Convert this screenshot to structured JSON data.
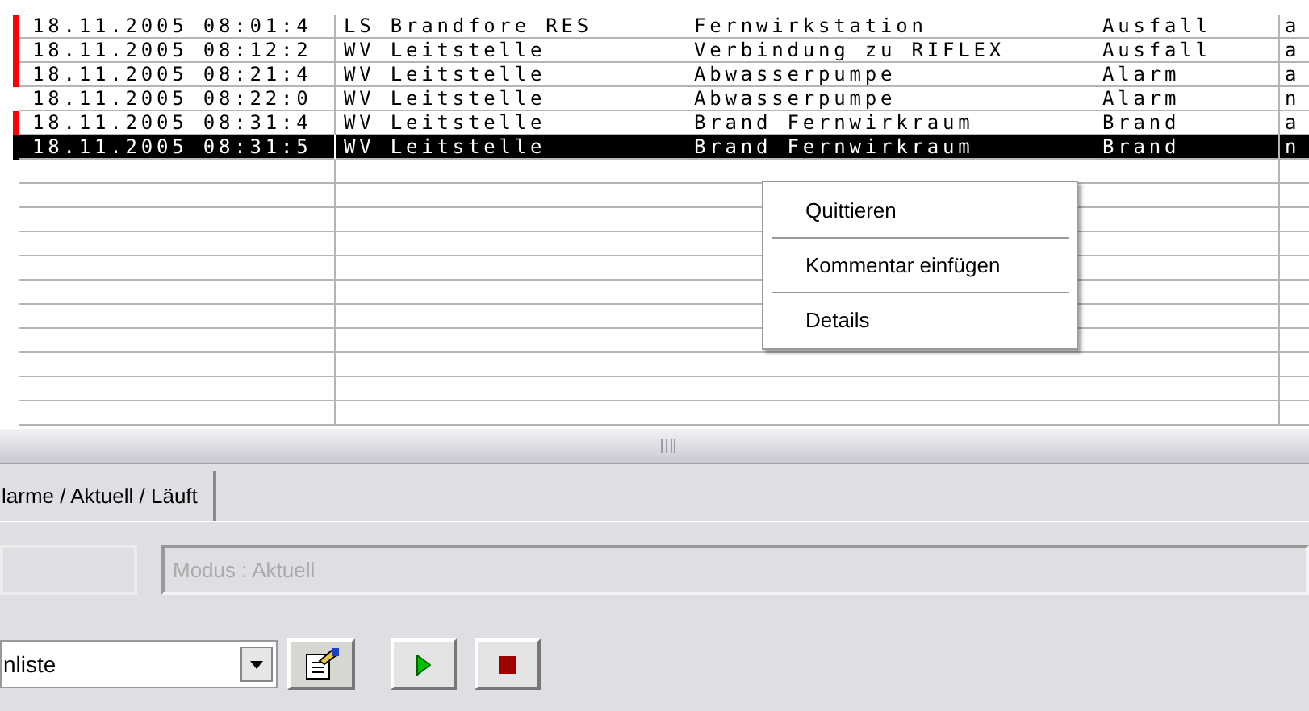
{
  "table": {
    "rows": [
      {
        "alarm": true,
        "selected": false,
        "time": "18.11.2005 08:01:4",
        "station": "LS Brandfore RES",
        "description": "Fernwirkstation",
        "type": "Ausfall",
        "column_5": "a"
      },
      {
        "alarm": true,
        "selected": false,
        "time": "18.11.2005 08:12:2",
        "station": "WV Leitstelle",
        "description": "Verbindung zu RIFLEX",
        "type": "Ausfall",
        "column_5": "a"
      },
      {
        "alarm": true,
        "selected": false,
        "time": "18.11.2005 08:21:4",
        "station": "WV Leitstelle",
        "description": "Abwasserpumpe",
        "type": "Alarm",
        "column_5": "a"
      },
      {
        "alarm": false,
        "selected": false,
        "time": "18.11.2005 08:22:0",
        "station": "WV Leitstelle",
        "description": "Abwasserpumpe",
        "type": "Alarm",
        "column_5": "n"
      },
      {
        "alarm": true,
        "selected": false,
        "time": "18.11.2005 08:31:4",
        "station": "WV Leitstelle",
        "description": "Brand Fernwirkraum",
        "type": "Brand",
        "column_5": "a"
      },
      {
        "alarm": false,
        "selected": true,
        "time": "18.11.2005 08:31:5",
        "station": "WV Leitstelle",
        "description": "Brand Fernwirkraum",
        "type": "Brand",
        "column_5": "n"
      }
    ]
  },
  "context_menu": [
    "Quittieren",
    "Kommentar einfügen",
    "Details"
  ],
  "tabs": [
    {
      "label": "larme / Aktuell / Läuft",
      "selected": true
    }
  ],
  "mode_field": {
    "value": "Modus : Aktuell",
    "disabled": true
  },
  "list_select": {
    "value": "nliste"
  }
}
